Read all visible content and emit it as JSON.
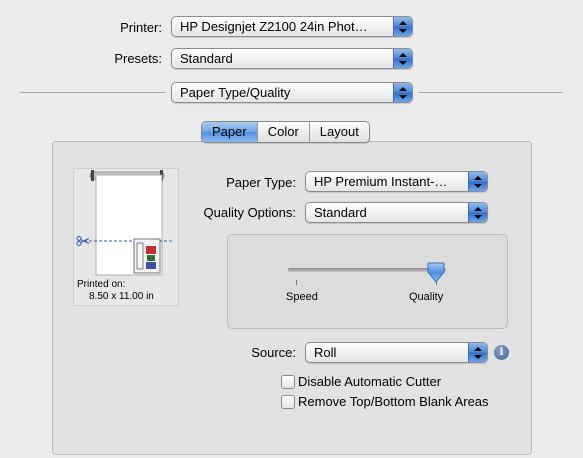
{
  "printer": {
    "label": "Printer:",
    "value": "HP Designjet Z2100 24in Phot…"
  },
  "presets": {
    "label": "Presets:",
    "value": "Standard"
  },
  "panel_menu": {
    "value": "Paper Type/Quality"
  },
  "tabs": [
    {
      "label": "Paper",
      "selected": true
    },
    {
      "label": "Color",
      "selected": false
    },
    {
      "label": "Layout",
      "selected": false
    }
  ],
  "preview": {
    "printed_on_label": "Printed on:",
    "size": "8.50 x 11.00 in"
  },
  "paper_type": {
    "label": "Paper Type:",
    "value": "HP Premium Instant-…"
  },
  "quality_options": {
    "label": "Quality Options:",
    "value": "Standard"
  },
  "quality_slider": {
    "min_label": "Speed",
    "max_label": "Quality",
    "level": 1.0
  },
  "source": {
    "label": "Source:",
    "value": "Roll"
  },
  "checkboxes": [
    {
      "label": "Disable Automatic Cutter",
      "checked": false
    },
    {
      "label": "Remove Top/Bottom Blank Areas",
      "checked": false
    }
  ],
  "colors": {
    "accent": "#4a86d9",
    "background": "#ececec",
    "panel": "#e2e2e2"
  },
  "icons": {
    "popup": "updown-arrows-icon",
    "info": "info-icon",
    "scissors": "scissors-icon"
  }
}
